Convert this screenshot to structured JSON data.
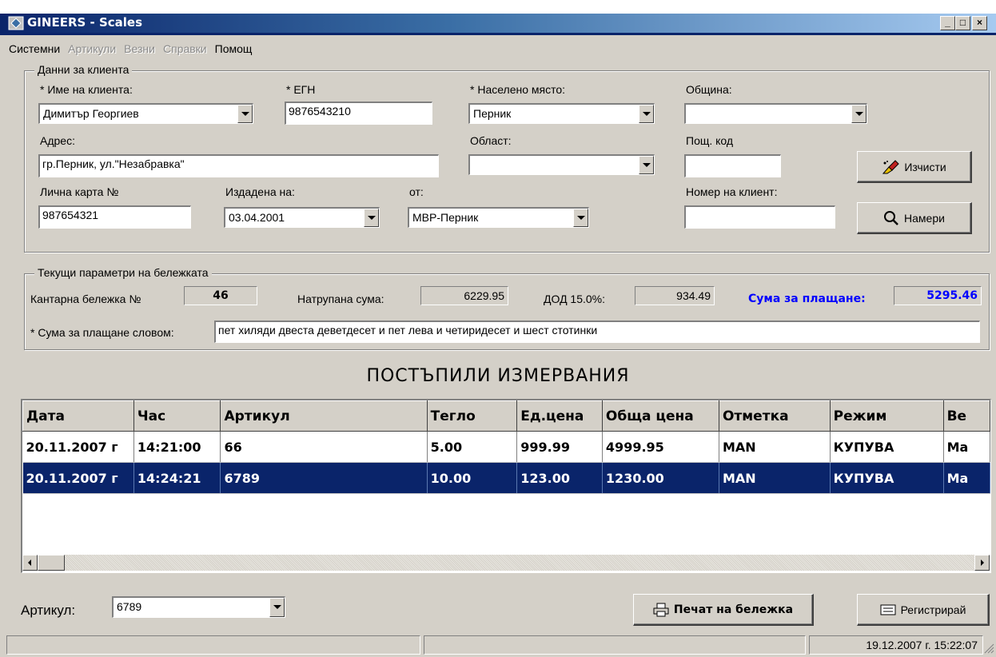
{
  "window": {
    "title": "GINEERS - Scales",
    "minimize": "_",
    "maximize": "□",
    "close": "×"
  },
  "menu": [
    "Системни",
    "Артикули",
    "Везни",
    "Справки",
    "Помощ"
  ],
  "client": {
    "group_title": "Данни за клиента",
    "name_label": "* Име на клиента:",
    "name_value": "Димитър Георгиев",
    "egn_label": "* ЕГН",
    "egn_value": "9876543210",
    "place_label": "* Населено място:",
    "place_value": "Перник",
    "municipality_label": "Община:",
    "municipality_value": "",
    "address_label": "Адрес:",
    "address_value": "гр.Перник, ул.\"Незабравка\"",
    "region_label": "Област:",
    "region_value": "",
    "postcode_label": "Пощ. код",
    "postcode_value": "",
    "id_card_label": "Лична карта №",
    "id_card_value": "987654321",
    "issued_on_label": "Издадена на:",
    "issued_on_value": "03.04.2001",
    "issued_by_label": "от:",
    "issued_by_value": "МВР-Перник",
    "client_no_label": "Номер на клиент:",
    "client_no_value": "",
    "clear_button": "Изчисти",
    "find_button": "Намери"
  },
  "receipt": {
    "group_title": "Текущи параметри на бележката",
    "number_label": "Кантарна бележка №",
    "number_value": "46",
    "accumulated_label": "Натрупана сума:",
    "accumulated_value": "6229.95",
    "tax_label": "ДОД 15.0%:",
    "tax_value": "934.49",
    "payable_label": "Сума за плащане:",
    "payable_value": "5295.46",
    "payable_color": "#0000ff",
    "words_label": "* Сума за плащане словом:",
    "words_value": "пет хиляди двеста деветдесет и пет лева и четиридесет и шест стотинки"
  },
  "measurements": {
    "title": "ПОСТЪПИЛИ  ИЗМЕРВАНИЯ",
    "columns": [
      "Дата",
      "Час",
      "Артикул",
      "Тегло",
      "Ед.цена",
      "Обща цена",
      "Отметка",
      "Режим",
      "Ве"
    ],
    "rows": [
      [
        "20.11.2007 г",
        "14:21:00",
        "66",
        "5.00",
        "999.99",
        "4999.95",
        "MAN",
        "КУПУВА",
        "Ма"
      ],
      [
        "20.11.2007 г",
        "14:24:21",
        "6789",
        "10.00",
        "123.00",
        "1230.00",
        "MAN",
        "КУПУВА",
        "Ма"
      ]
    ],
    "selected_row": 1,
    "selection_color": "#0a246a"
  },
  "bottom": {
    "article_label": "Артикул:",
    "article_value": "6789",
    "print_button": "Печат на бележка",
    "register_button": "Регистрирай"
  },
  "status": {
    "datetime": "19.12.2007 г.   15:22:07"
  }
}
